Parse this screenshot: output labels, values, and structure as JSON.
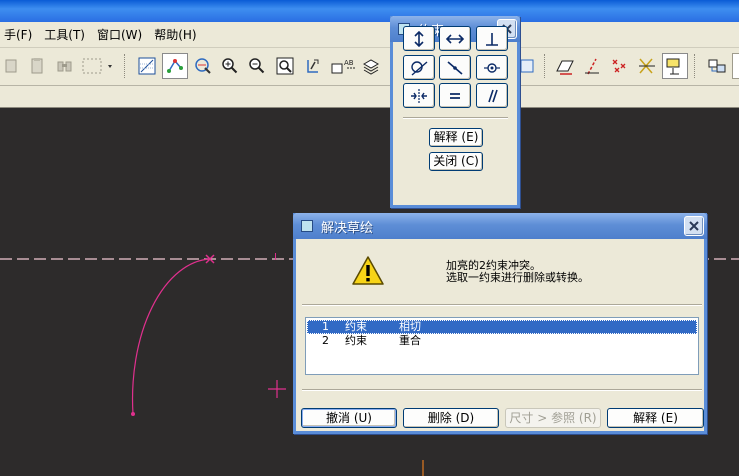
{
  "menubar": {
    "items": [
      "手(F)",
      "工具(T)",
      "窗口(W)",
      "帮助(H)"
    ]
  },
  "constraint_palette": {
    "title": "约束",
    "buttons": [
      {
        "icon": "vertical-arrow-icon"
      },
      {
        "icon": "horizontal-arrow-icon"
      },
      {
        "icon": "perpendicular-icon"
      },
      {
        "icon": "tangent-icon"
      },
      {
        "icon": "point-on-line-icon"
      },
      {
        "icon": "coincident-point-icon"
      },
      {
        "icon": "symmetric-icon"
      },
      {
        "icon": "equal-icon"
      },
      {
        "icon": "parallel-icon"
      }
    ],
    "explain_label": "解释 (E)",
    "close_label": "关闭 (C)"
  },
  "resolve_dialog": {
    "title": "解决草绘",
    "message_line1": "加亮的2约束冲突。",
    "message_line2": "选取一约束进行删除或转换。",
    "conflicts": [
      {
        "index": "1",
        "type": "约束",
        "detail": "相切",
        "selected": true
      },
      {
        "index": "2",
        "type": "约束",
        "detail": "重合",
        "selected": false
      }
    ],
    "buttons": {
      "undo": "撤消 (U)",
      "delete": "删除 (D)",
      "dim_to_ref": "尺寸 > 参照 (R)",
      "explain": "解释 (E)"
    }
  },
  "colors": {
    "sketch_magenta": "#e0308e",
    "centerline_pink": "#f2c8d4",
    "canvas_bg": "#2d2b2b",
    "selection_blue": "#316ac5"
  },
  "canvas_labels": {
    "centerline_tag": "I"
  }
}
